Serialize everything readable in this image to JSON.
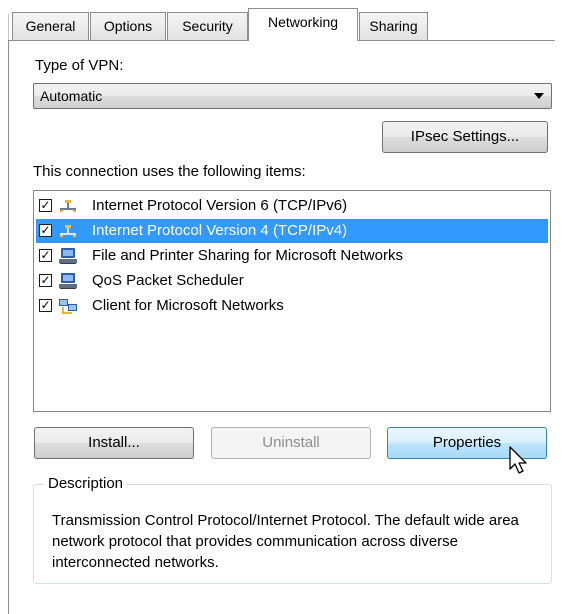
{
  "tabs": [
    {
      "label": "General",
      "active": false
    },
    {
      "label": "Options",
      "active": false
    },
    {
      "label": "Security",
      "active": false
    },
    {
      "label": "Networking",
      "active": true
    },
    {
      "label": "Sharing",
      "active": false
    }
  ],
  "vpn": {
    "type_label": "Type of VPN:",
    "selected": "Automatic"
  },
  "ipsec_button": "IPsec Settings...",
  "items_label": "This connection uses the following items:",
  "items": [
    {
      "label": "Internet Protocol Version 6 (TCP/IPv6)",
      "checked": true,
      "icon": "network-protocol-icon",
      "selected": false
    },
    {
      "label": "Internet Protocol Version 4 (TCP/IPv4)",
      "checked": true,
      "icon": "network-protocol-icon",
      "selected": true
    },
    {
      "label": "File and Printer Sharing for Microsoft Networks",
      "checked": true,
      "icon": "network-service-icon",
      "selected": false
    },
    {
      "label": "QoS Packet Scheduler",
      "checked": true,
      "icon": "network-service-icon",
      "selected": false
    },
    {
      "label": "Client for Microsoft Networks",
      "checked": true,
      "icon": "network-client-icon",
      "selected": false
    }
  ],
  "buttons": {
    "install": "Install...",
    "uninstall": "Uninstall",
    "properties": "Properties"
  },
  "description": {
    "title": "Description",
    "text": "Transmission Control Protocol/Internet Protocol. The default wide area network protocol that provides communication across diverse interconnected networks."
  },
  "colors": {
    "selection": "#3399ff",
    "hot_button_border": "#3c7fb1"
  }
}
